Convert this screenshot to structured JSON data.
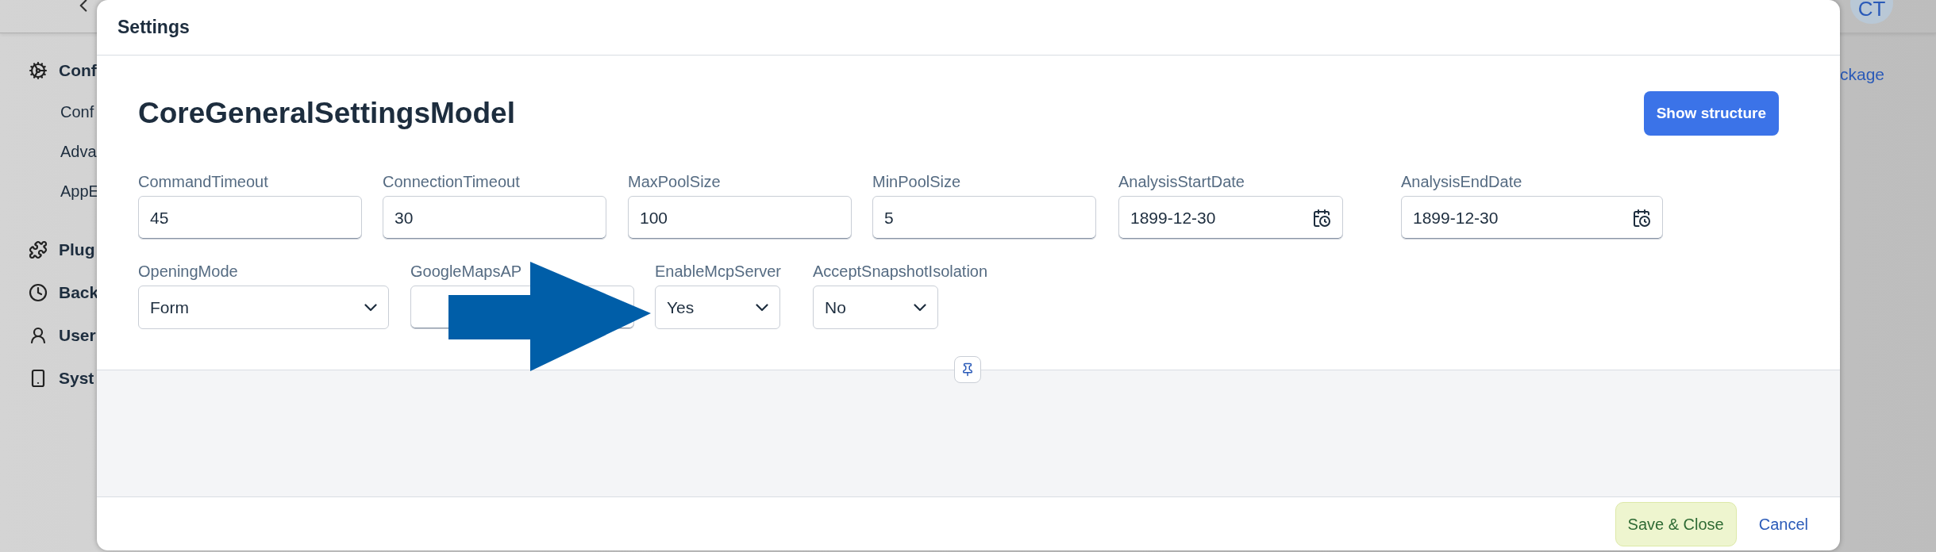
{
  "background": {
    "sidebar": [
      {
        "kind": "group",
        "label": "Conf"
      },
      {
        "kind": "item",
        "label": "Conf"
      },
      {
        "kind": "item",
        "label": "Adva"
      },
      {
        "kind": "item",
        "label": "AppE"
      },
      {
        "kind": "group",
        "label": "Plug"
      },
      {
        "kind": "group",
        "label": "Back"
      },
      {
        "kind": "group",
        "label": "User"
      },
      {
        "kind": "group",
        "label": "Syst"
      }
    ],
    "avatar": "CT",
    "link": "ckage"
  },
  "dialog": {
    "title": "Settings",
    "heading": "CoreGeneralSettingsModel",
    "show_structure_button": "Show structure",
    "rows": [
      [
        {
          "kind": "text",
          "label": "CommandTimeout",
          "value": "45"
        },
        {
          "kind": "text",
          "label": "ConnectionTimeout",
          "value": "30"
        },
        {
          "kind": "text",
          "label": "MaxPoolSize",
          "value": "100"
        },
        {
          "kind": "text",
          "label": "MinPoolSize",
          "value": "5"
        },
        {
          "kind": "date",
          "label": "AnalysisStartDate",
          "value": "1899-12-30"
        },
        {
          "kind": "date",
          "label": "AnalysisEndDate",
          "value": "1899-12-30"
        }
      ],
      [
        {
          "kind": "select",
          "label": "OpeningMode",
          "value": "Form"
        },
        {
          "kind": "text",
          "label": "GoogleMapsAP"
        },
        {
          "kind": "select",
          "label": "EnableMcpServer",
          "value": "Yes"
        },
        {
          "kind": "select",
          "label": "AcceptSnapshotIsolation",
          "value": "No"
        }
      ]
    ],
    "footer": {
      "save_button": "Save & Close",
      "cancel_button": "Cancel"
    }
  }
}
